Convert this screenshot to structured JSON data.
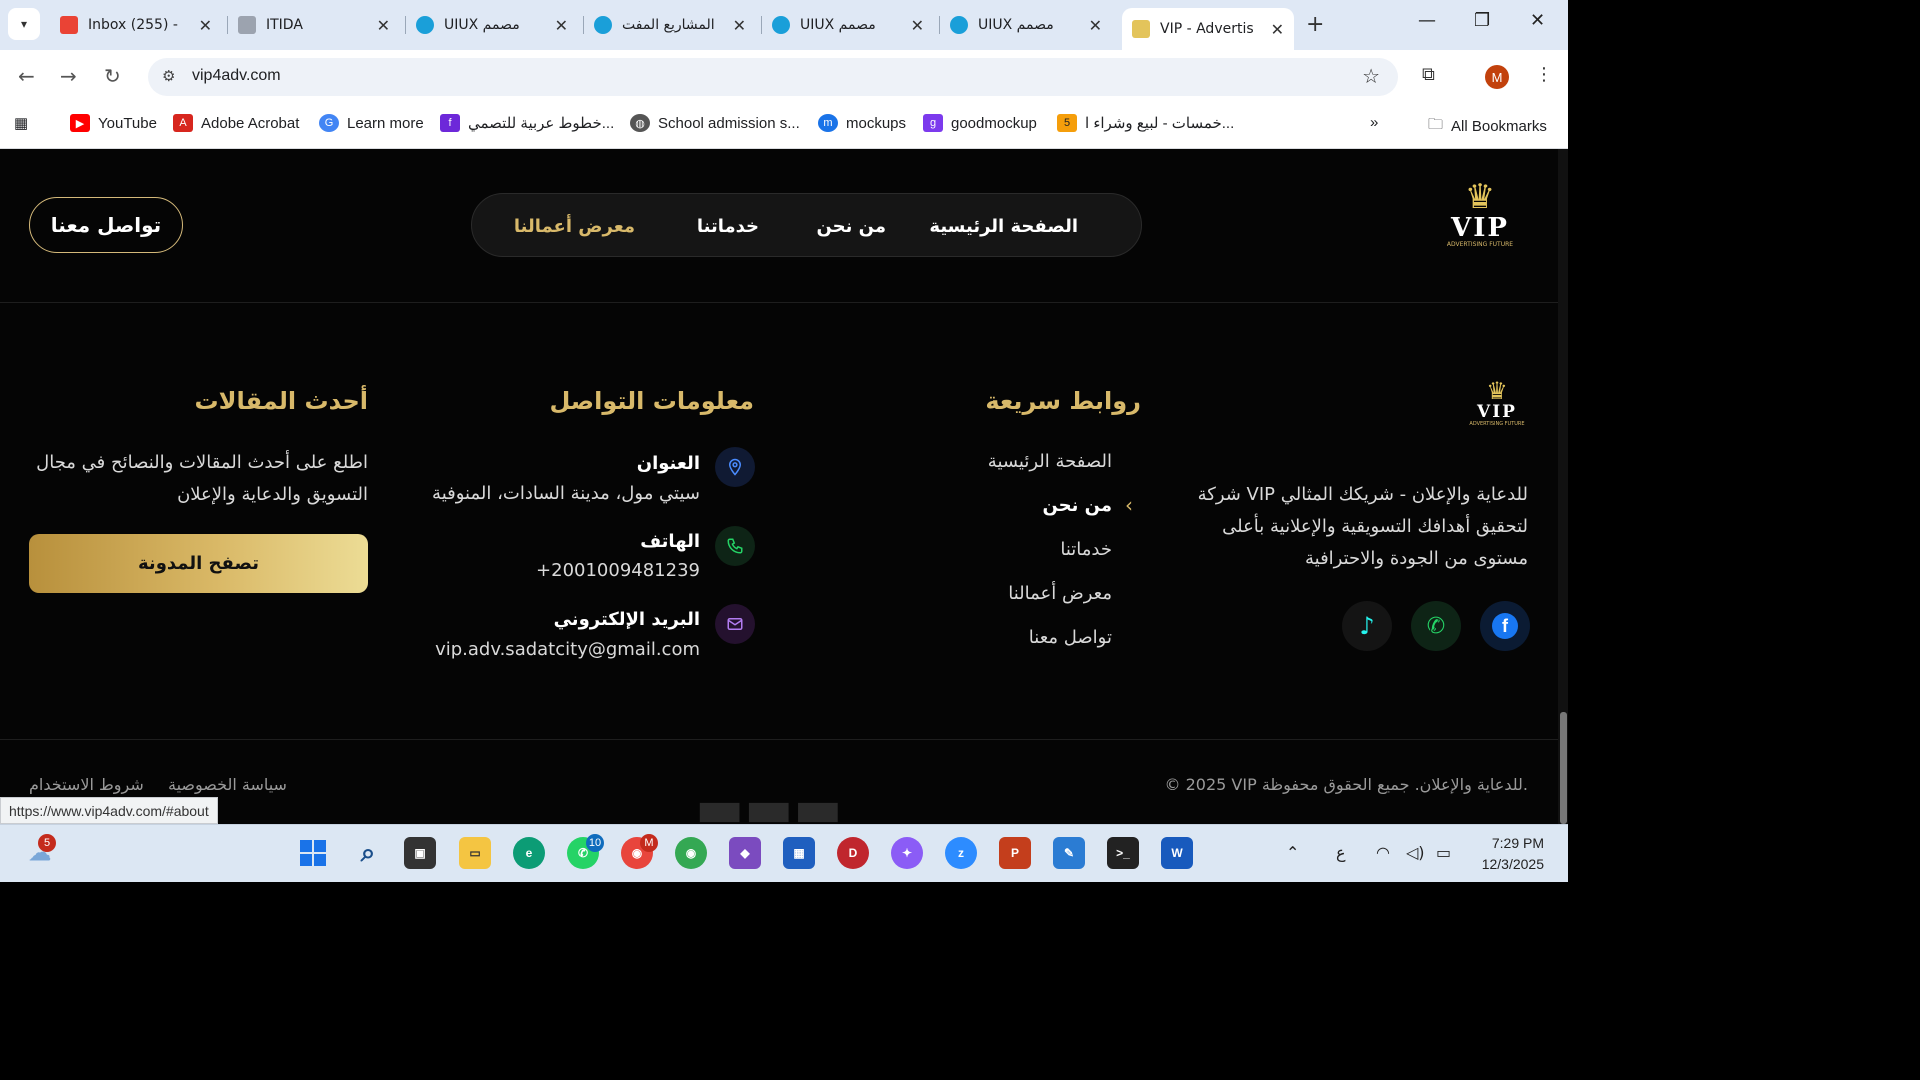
{
  "browser": {
    "tabs": [
      {
        "title": "Inbox (255) - ",
        "favicon_color": "#ea4335"
      },
      {
        "title": "ITIDA",
        "favicon_color": "#6b7280"
      },
      {
        "title": "UIUX مصمم",
        "favicon_color": "#1a9fd9"
      },
      {
        "title": "المشاريع المفت",
        "favicon_color": "#1a9fd9"
      },
      {
        "title": "UIUX مصمم",
        "favicon_color": "#1a9fd9"
      },
      {
        "title": "UIUX مصمم",
        "favicon_color": "#1a9fd9"
      },
      {
        "title": "VIP - Advertis",
        "favicon_color": "#e3c45b",
        "active": true
      }
    ],
    "url": "vip4adv.com",
    "profile_initial": "M",
    "bookmarks": [
      {
        "label": "YouTube",
        "icon": "youtube-icon",
        "color": "#ff0000"
      },
      {
        "label": "Adobe Acrobat",
        "icon": "acrobat-icon",
        "color": "#d7261e"
      },
      {
        "label": "Learn more",
        "icon": "google-icon",
        "color": "#4285f4"
      },
      {
        "label": "خطوط عربية للتصمي...",
        "icon": "fonts-site-icon",
        "color": "#6d28d9"
      },
      {
        "label": "School admission s...",
        "icon": "globe-icon",
        "color": "#555555"
      },
      {
        "label": "mockups",
        "icon": "mockups-icon",
        "color": "#1a73e8"
      },
      {
        "label": "goodmockup",
        "icon": "goodmockup-icon",
        "color": "#7c3aed"
      },
      {
        "label": "خمسات - لبيع وشراء ا...",
        "icon": "khamsat-icon",
        "color": "#f59e0b"
      }
    ],
    "all_bookmarks_label": "All Bookmarks",
    "status_url": "https://www.vip4adv.com/#about"
  },
  "site": {
    "header": {
      "contact_button": "تواصل معنا",
      "nav": [
        "الصفحة الرئيسية",
        "من نحن",
        "خدماتنا",
        "معرض أعمالنا"
      ],
      "active_nav_index": 3
    },
    "logo": {
      "wordmark": "VIP",
      "tagline": "ADVERTISING FUTURE"
    },
    "about": {
      "lines": [
        "شركة VIP للدعاية والإعلان - شريكك المثالي",
        "لتحقيق أهدافك التسويقية والإعلانية بأعلى",
        "مستوى من الجودة والاحترافية"
      ],
      "socials": [
        {
          "icon": "tiktok-icon",
          "color": "#25f4ee"
        },
        {
          "icon": "whatsapp-icon",
          "color": "#25d366"
        },
        {
          "icon": "facebook-icon",
          "color": "#1877f2"
        }
      ]
    },
    "quick_links": {
      "title": "روابط سريعة",
      "items": [
        "الصفحة الرئيسية",
        "من نحن",
        "خدماتنا",
        "معرض أعمالنا",
        "تواصل معنا"
      ],
      "active_index": 1
    },
    "contact_info": {
      "title": "معلومات التواصل",
      "address_label": "العنوان",
      "address_value": "سيتي مول، مدينة السادات، المنوفية",
      "phone_label": "الهاتف",
      "phone_value": "+2001009481239",
      "email_label": "البريد الإلكتروني",
      "email_value": "vip.adv.sadatcity@gmail.com"
    },
    "articles": {
      "title": "أحدث المقالات",
      "lines": [
        "اطلع على أحدث المقالات والنصائح في مجال",
        "التسويق والدعاية والإعلان"
      ],
      "button": "تصفح المدونة"
    },
    "footer": {
      "copyright": "© 2025 VIP للدعاية والإعلان. جميع الحقوق محفوظة.",
      "privacy": "سياسة الخصوصية",
      "terms": "شروط الاستخدام"
    }
  },
  "taskbar": {
    "weather_badge": "5",
    "whatsapp_badge": "10",
    "gmail_badge": "M",
    "language": "ع",
    "time": "7:29 PM",
    "date": "12/3/2025"
  }
}
